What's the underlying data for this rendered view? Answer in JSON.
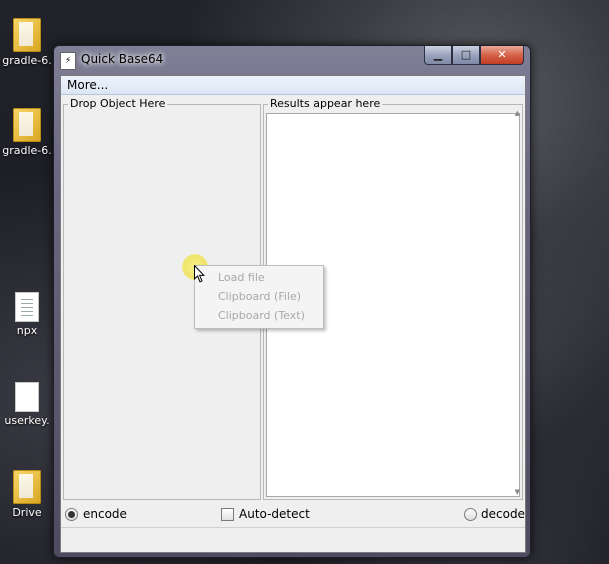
{
  "desktop": {
    "icons": [
      {
        "label": "gradle-6.",
        "icon": "folder-zip-icon"
      },
      {
        "label": "gradle-6.",
        "icon": "folder-icon"
      },
      {
        "label": "npx",
        "icon": "text-file-icon"
      },
      {
        "label": "userkey.",
        "icon": "file-icon"
      },
      {
        "label": "Drive",
        "icon": "folder-icon"
      }
    ]
  },
  "window": {
    "title": "Quick Base64",
    "icon": "app-icon",
    "menu": {
      "more_label": "More..."
    },
    "drop_group_label": "Drop Object Here",
    "results_group_label": "Results appear here",
    "results_text": "",
    "options": {
      "encode_label": "encode",
      "encode_selected": true,
      "autodetect_label": "Auto-detect",
      "autodetect_checked": false,
      "decode_label": "decode",
      "decode_selected": false
    }
  },
  "context_menu": {
    "items": [
      {
        "label": "Load file",
        "enabled": false
      },
      {
        "label": "Clipboard (File)",
        "enabled": false
      },
      {
        "label": "Clipboard (Text)",
        "enabled": false
      }
    ]
  },
  "caption_buttons": {
    "minimize": "minimize-icon",
    "maximize": "maximize-icon",
    "close": "close-icon"
  }
}
